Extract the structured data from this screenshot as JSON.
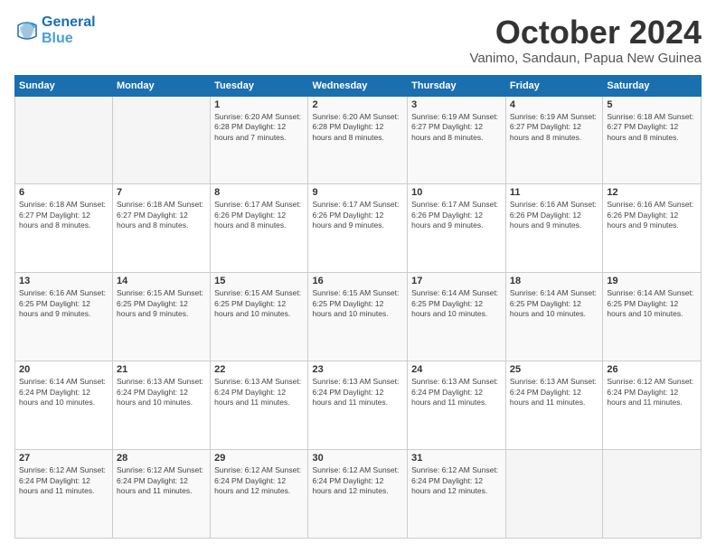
{
  "logo": {
    "line1": "General",
    "line2": "Blue"
  },
  "header": {
    "title": "October 2024",
    "location": "Vanimo, Sandaun, Papua New Guinea"
  },
  "days_of_week": [
    "Sunday",
    "Monday",
    "Tuesday",
    "Wednesday",
    "Thursday",
    "Friday",
    "Saturday"
  ],
  "weeks": [
    [
      {
        "day": "",
        "info": ""
      },
      {
        "day": "",
        "info": ""
      },
      {
        "day": "1",
        "info": "Sunrise: 6:20 AM\nSunset: 6:28 PM\nDaylight: 12 hours and 7 minutes."
      },
      {
        "day": "2",
        "info": "Sunrise: 6:20 AM\nSunset: 6:28 PM\nDaylight: 12 hours and 8 minutes."
      },
      {
        "day": "3",
        "info": "Sunrise: 6:19 AM\nSunset: 6:27 PM\nDaylight: 12 hours and 8 minutes."
      },
      {
        "day": "4",
        "info": "Sunrise: 6:19 AM\nSunset: 6:27 PM\nDaylight: 12 hours and 8 minutes."
      },
      {
        "day": "5",
        "info": "Sunrise: 6:18 AM\nSunset: 6:27 PM\nDaylight: 12 hours and 8 minutes."
      }
    ],
    [
      {
        "day": "6",
        "info": "Sunrise: 6:18 AM\nSunset: 6:27 PM\nDaylight: 12 hours and 8 minutes."
      },
      {
        "day": "7",
        "info": "Sunrise: 6:18 AM\nSunset: 6:27 PM\nDaylight: 12 hours and 8 minutes."
      },
      {
        "day": "8",
        "info": "Sunrise: 6:17 AM\nSunset: 6:26 PM\nDaylight: 12 hours and 8 minutes."
      },
      {
        "day": "9",
        "info": "Sunrise: 6:17 AM\nSunset: 6:26 PM\nDaylight: 12 hours and 9 minutes."
      },
      {
        "day": "10",
        "info": "Sunrise: 6:17 AM\nSunset: 6:26 PM\nDaylight: 12 hours and 9 minutes."
      },
      {
        "day": "11",
        "info": "Sunrise: 6:16 AM\nSunset: 6:26 PM\nDaylight: 12 hours and 9 minutes."
      },
      {
        "day": "12",
        "info": "Sunrise: 6:16 AM\nSunset: 6:26 PM\nDaylight: 12 hours and 9 minutes."
      }
    ],
    [
      {
        "day": "13",
        "info": "Sunrise: 6:16 AM\nSunset: 6:25 PM\nDaylight: 12 hours and 9 minutes."
      },
      {
        "day": "14",
        "info": "Sunrise: 6:15 AM\nSunset: 6:25 PM\nDaylight: 12 hours and 9 minutes."
      },
      {
        "day": "15",
        "info": "Sunrise: 6:15 AM\nSunset: 6:25 PM\nDaylight: 12 hours and 10 minutes."
      },
      {
        "day": "16",
        "info": "Sunrise: 6:15 AM\nSunset: 6:25 PM\nDaylight: 12 hours and 10 minutes."
      },
      {
        "day": "17",
        "info": "Sunrise: 6:14 AM\nSunset: 6:25 PM\nDaylight: 12 hours and 10 minutes."
      },
      {
        "day": "18",
        "info": "Sunrise: 6:14 AM\nSunset: 6:25 PM\nDaylight: 12 hours and 10 minutes."
      },
      {
        "day": "19",
        "info": "Sunrise: 6:14 AM\nSunset: 6:25 PM\nDaylight: 12 hours and 10 minutes."
      }
    ],
    [
      {
        "day": "20",
        "info": "Sunrise: 6:14 AM\nSunset: 6:24 PM\nDaylight: 12 hours and 10 minutes."
      },
      {
        "day": "21",
        "info": "Sunrise: 6:13 AM\nSunset: 6:24 PM\nDaylight: 12 hours and 10 minutes."
      },
      {
        "day": "22",
        "info": "Sunrise: 6:13 AM\nSunset: 6:24 PM\nDaylight: 12 hours and 11 minutes."
      },
      {
        "day": "23",
        "info": "Sunrise: 6:13 AM\nSunset: 6:24 PM\nDaylight: 12 hours and 11 minutes."
      },
      {
        "day": "24",
        "info": "Sunrise: 6:13 AM\nSunset: 6:24 PM\nDaylight: 12 hours and 11 minutes."
      },
      {
        "day": "25",
        "info": "Sunrise: 6:13 AM\nSunset: 6:24 PM\nDaylight: 12 hours and 11 minutes."
      },
      {
        "day": "26",
        "info": "Sunrise: 6:12 AM\nSunset: 6:24 PM\nDaylight: 12 hours and 11 minutes."
      }
    ],
    [
      {
        "day": "27",
        "info": "Sunrise: 6:12 AM\nSunset: 6:24 PM\nDaylight: 12 hours and 11 minutes."
      },
      {
        "day": "28",
        "info": "Sunrise: 6:12 AM\nSunset: 6:24 PM\nDaylight: 12 hours and 11 minutes."
      },
      {
        "day": "29",
        "info": "Sunrise: 6:12 AM\nSunset: 6:24 PM\nDaylight: 12 hours and 12 minutes."
      },
      {
        "day": "30",
        "info": "Sunrise: 6:12 AM\nSunset: 6:24 PM\nDaylight: 12 hours and 12 minutes."
      },
      {
        "day": "31",
        "info": "Sunrise: 6:12 AM\nSunset: 6:24 PM\nDaylight: 12 hours and 12 minutes."
      },
      {
        "day": "",
        "info": ""
      },
      {
        "day": "",
        "info": ""
      }
    ]
  ]
}
